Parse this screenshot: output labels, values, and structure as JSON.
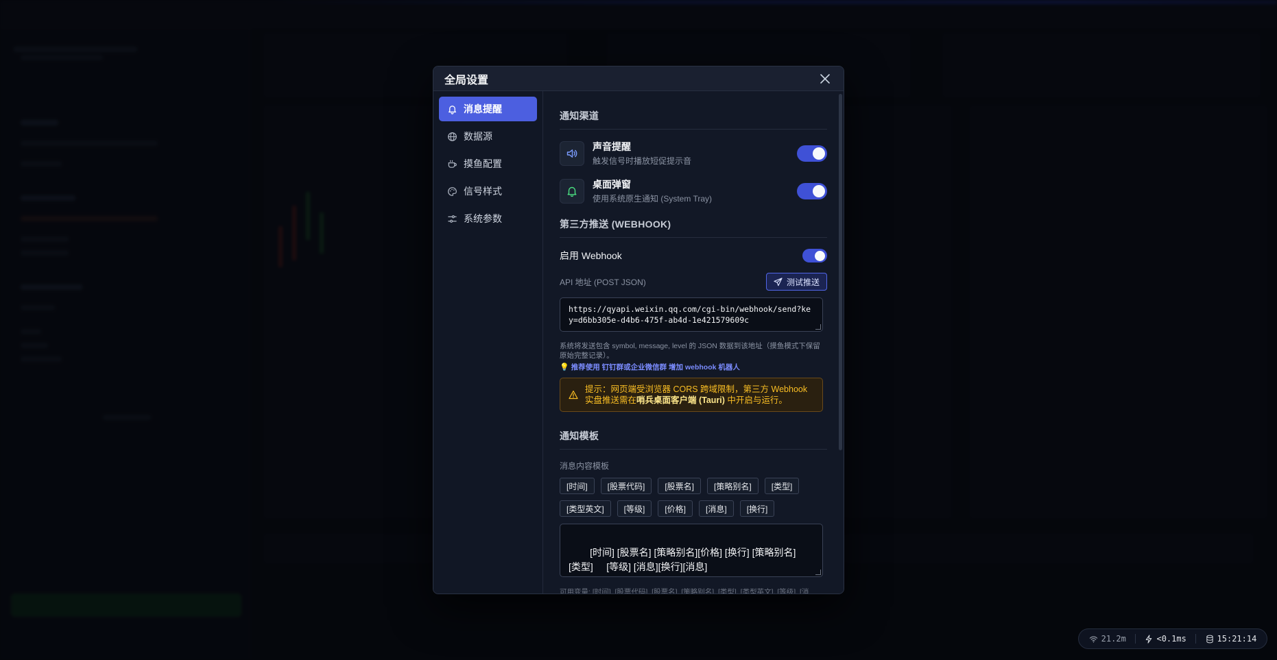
{
  "modal": {
    "title": "全局设置",
    "nav": [
      {
        "label": "消息提醒",
        "icon": "bell-icon",
        "active": true
      },
      {
        "label": "数据源",
        "icon": "globe-icon",
        "active": false
      },
      {
        "label": "摸鱼配置",
        "icon": "coffee-icon",
        "active": false
      },
      {
        "label": "信号样式",
        "icon": "palette-icon",
        "active": false
      },
      {
        "label": "系统参数",
        "icon": "sliders-icon",
        "active": false
      }
    ],
    "channels": {
      "title": "通知渠道",
      "sound": {
        "title": "声音提醒",
        "desc": "触发信号时播放短促提示音",
        "enabled": true
      },
      "desktop": {
        "title": "桌面弹窗",
        "desc": "使用系统原生通知 (System Tray)",
        "enabled": true
      }
    },
    "webhook": {
      "title": "第三方推送 (WEBHOOK)",
      "enable_label": "启用 Webhook",
      "enabled": true,
      "api_label": "API 地址 (POST JSON)",
      "test_button": "测试推送",
      "url": "https://qyapi.weixin.qq.com/cgi-bin/webhook/send?key=d6bb305e-d4b6-475f-ab4d-1e421579609c",
      "help": "系统将发送包含 symbol, message, level 的 JSON 数据到该地址（摸鱼模式下保留原始完整记录）。",
      "tip": "推荐使用 钉钉群或企业微信群 增加 webhook 机器人",
      "warning_prefix": "提示：网页端受浏览器 CORS 跨域限制，第三方 Webhook 实盘推送需在",
      "warning_bold": "哨兵桌面客户端 (Tauri)",
      "warning_suffix": " 中开启与运行。"
    },
    "template": {
      "title": "通知模板",
      "label": "消息内容模板",
      "chips": [
        "[时间]",
        "[股票代码]",
        "[股票名]",
        "[策略别名]",
        "[类型]",
        "[类型英文]",
        "[等级]",
        "[价格]",
        "[消息]",
        "[换行]"
      ],
      "value": "[时间] [股票名] [策略别名][价格] [换行] [策略别名]     [类型]     [等级] [消息][换行][消息]",
      "vars": "可用变量: [时间], [股票代码], [股票名], [策略别名], [类型], [类型英文], [等级], [消"
    }
  },
  "status": {
    "network": "21.2m",
    "latency": "<0.1ms",
    "time": "15:21:14"
  }
}
